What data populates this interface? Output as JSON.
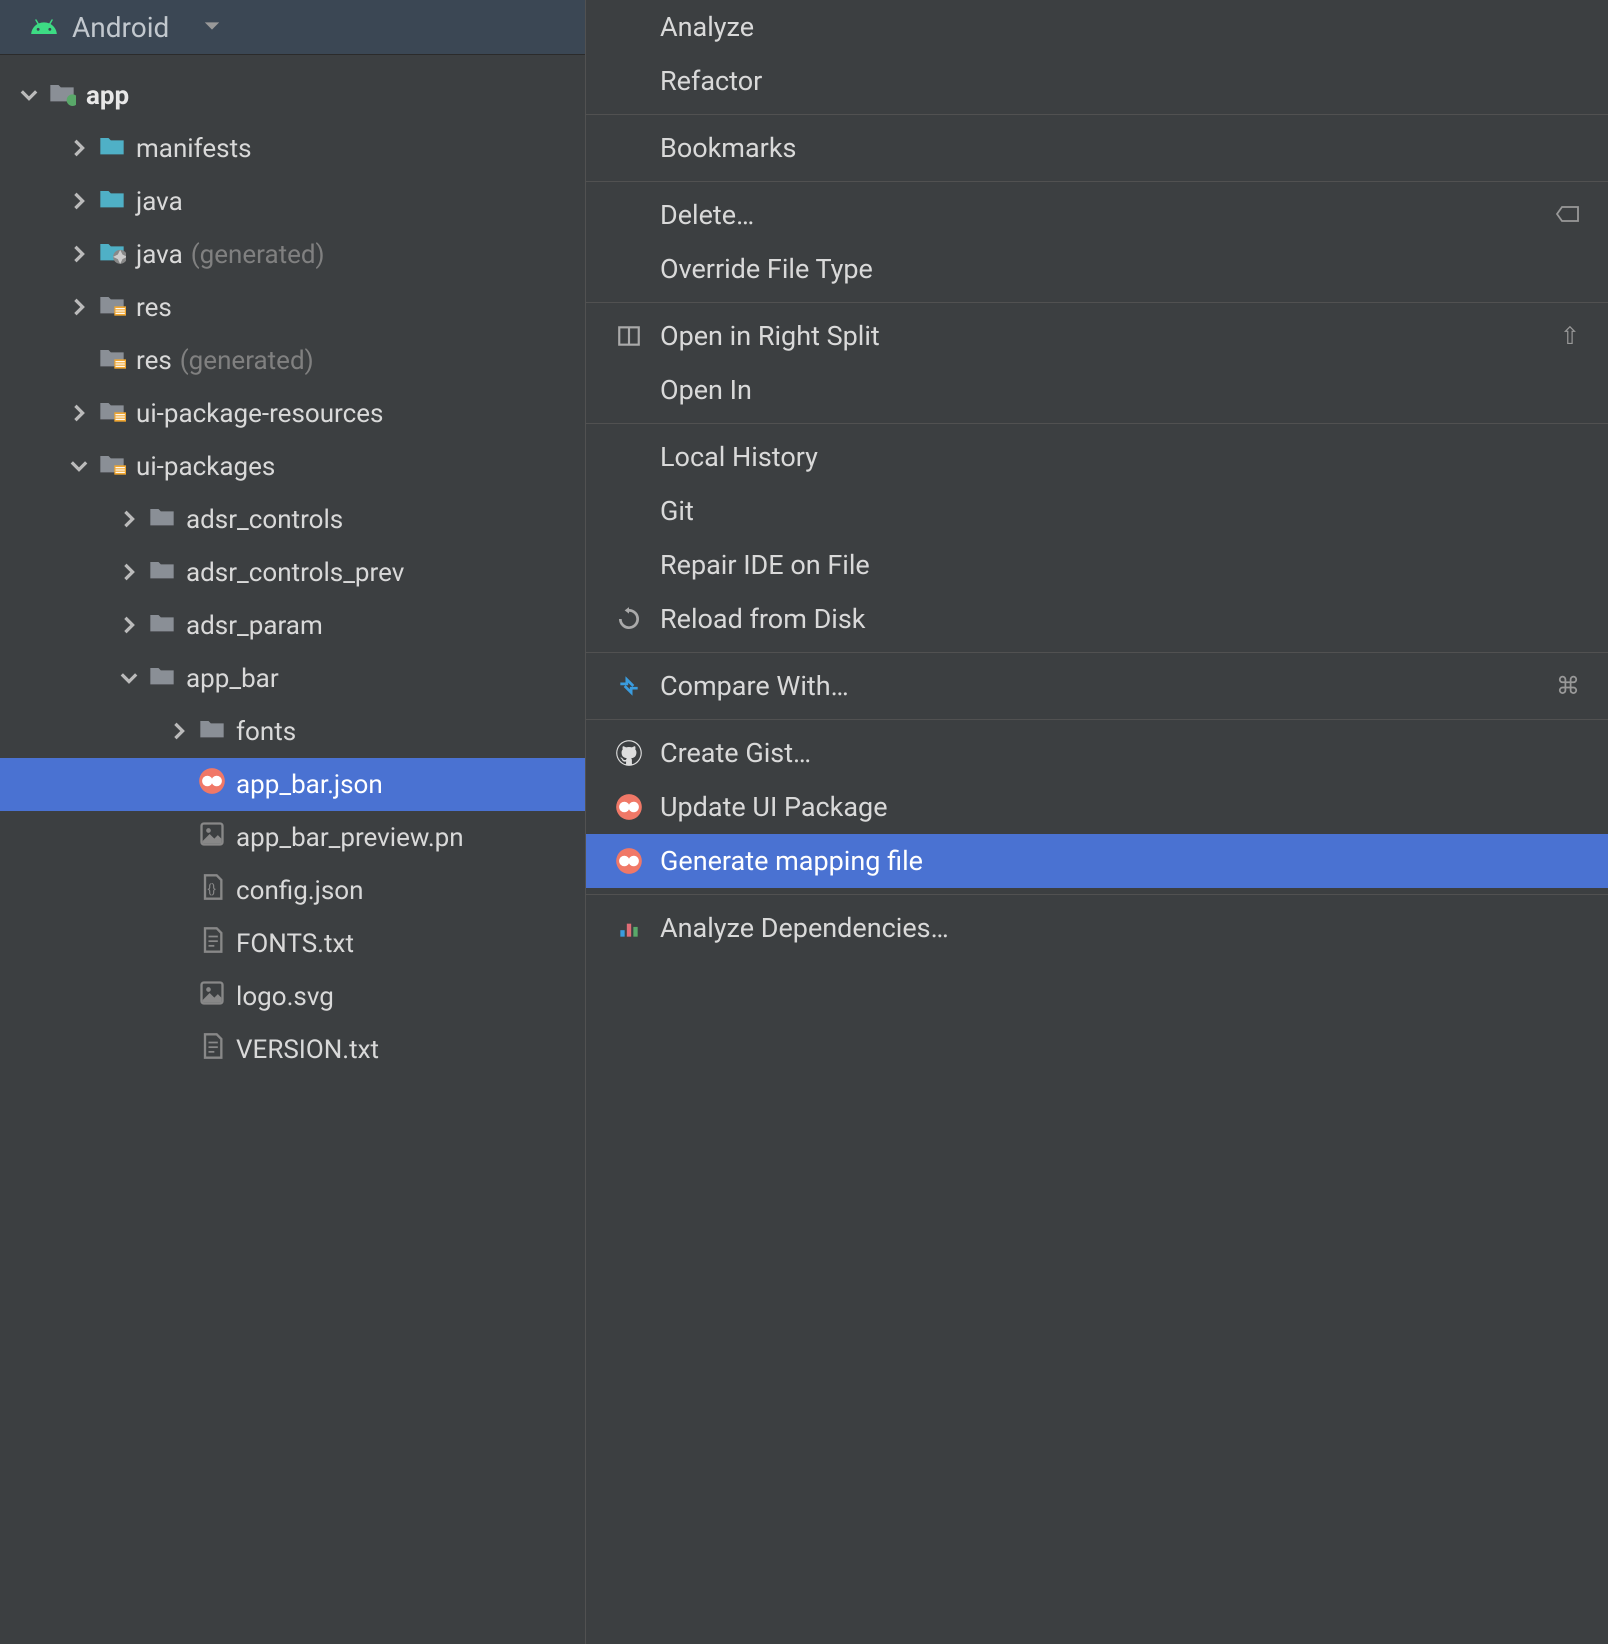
{
  "header": {
    "title": "Android"
  },
  "tree": {
    "root": {
      "label": "app",
      "children": [
        {
          "label": "manifests",
          "icon": "folder-teal"
        },
        {
          "label": "java",
          "icon": "folder-teal"
        },
        {
          "label": "java",
          "secondary": "(generated)",
          "icon": "folder-gen"
        },
        {
          "label": "res",
          "icon": "folder-res"
        },
        {
          "label": "res",
          "secondary": "(generated)",
          "icon": "folder-res",
          "noarrow": true
        },
        {
          "label": "ui-package-resources",
          "icon": "folder-res"
        },
        {
          "label": "ui-packages",
          "icon": "folder-res",
          "expanded": true,
          "children": [
            {
              "label": "adsr_controls",
              "icon": "folder-gray"
            },
            {
              "label": "adsr_controls_prev",
              "icon": "folder-gray"
            },
            {
              "label": "adsr_param",
              "icon": "folder-gray"
            },
            {
              "label": "app_bar",
              "icon": "folder-gray",
              "expanded": true,
              "children": [
                {
                  "label": "fonts",
                  "icon": "folder-gray"
                },
                {
                  "label": "app_bar.json",
                  "icon": "relay",
                  "selected": true,
                  "noarrow": true
                },
                {
                  "label": "app_bar_preview.pn",
                  "icon": "image",
                  "noarrow": true
                },
                {
                  "label": "config.json",
                  "icon": "json",
                  "noarrow": true
                },
                {
                  "label": "FONTS.txt",
                  "icon": "text",
                  "noarrow": true
                },
                {
                  "label": "logo.svg",
                  "icon": "image",
                  "noarrow": true
                },
                {
                  "label": "VERSION.txt",
                  "icon": "text",
                  "noarrow": true
                }
              ]
            }
          ]
        }
      ]
    }
  },
  "menu": [
    {
      "type": "item",
      "label": "Analyze"
    },
    {
      "type": "item",
      "label": "Refactor"
    },
    {
      "type": "separator"
    },
    {
      "type": "item",
      "label": "Bookmarks"
    },
    {
      "type": "separator"
    },
    {
      "type": "item",
      "label": "Delete…",
      "shortcut_icon": "delete"
    },
    {
      "type": "item",
      "label": "Override File Type"
    },
    {
      "type": "separator"
    },
    {
      "type": "item",
      "label": "Open in Right Split",
      "icon": "split",
      "shortcut": "⇧"
    },
    {
      "type": "item",
      "label": "Open In"
    },
    {
      "type": "separator"
    },
    {
      "type": "item",
      "label": "Local History"
    },
    {
      "type": "item",
      "label": "Git"
    },
    {
      "type": "item",
      "label": "Repair IDE on File"
    },
    {
      "type": "item",
      "label": "Reload from Disk",
      "icon": "reload"
    },
    {
      "type": "separator"
    },
    {
      "type": "item",
      "label": "Compare With…",
      "icon": "compare",
      "shortcut": "⌘"
    },
    {
      "type": "separator"
    },
    {
      "type": "item",
      "label": "Create Gist…",
      "icon": "github"
    },
    {
      "type": "item",
      "label": "Update UI Package",
      "icon": "relay"
    },
    {
      "type": "item",
      "label": "Generate mapping file",
      "icon": "relay",
      "selected": true
    },
    {
      "type": "separator"
    },
    {
      "type": "item",
      "label": "Analyze Dependencies…",
      "icon": "chart"
    }
  ]
}
